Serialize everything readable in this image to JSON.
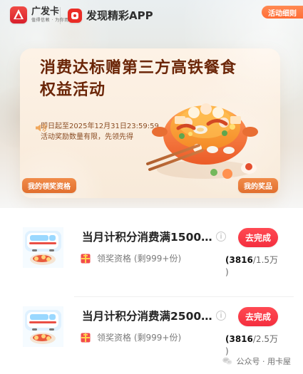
{
  "brand": {
    "name": "广发卡",
    "sub": "值得信赖 · 为你而来"
  },
  "header": {
    "app_promo": "发现精彩APP",
    "activity_detail": "活动细则"
  },
  "hero": {
    "title_line1": "消费达标赠第三方高铁餐食",
    "title_line2": "权益活动",
    "desc_line1": "即日起至2025年12月31日23:59:59,",
    "desc_line2": "活动奖励数量有限，先领先得",
    "left_button": "我的领奖资格",
    "right_button": "我的奖品"
  },
  "tasks": [
    {
      "title": "当月计积分消费满1500...",
      "reward": "领奖资格 (剩999+份)",
      "button": "去完成",
      "progress_prefix": "(3816",
      "progress_total": "/1.5万",
      "progress_suffix": ")"
    },
    {
      "title": "当月计积分消费满2500...",
      "reward": "领奖资格 (剩999+份)",
      "button": "去完成",
      "progress_prefix": "(3816",
      "progress_total": "/2.5万",
      "progress_suffix": ")"
    }
  ],
  "footer": {
    "watermark": "公众号 · 用卡屋"
  },
  "icons": {
    "brand_logo": "brand-logo",
    "app_icon": "app-icon",
    "speaker_icon": "speaker-icon",
    "hotpot_illustration": "hotpot-illustration",
    "train_food_thumb": "train-food-thumbnail",
    "gift_icon": "gift-icon",
    "info_icon": "info-icon",
    "wechat_icon": "wechat-icon"
  },
  "colors": {
    "accent_red": "#f42e3e",
    "accent_orange": "#ff6d36",
    "title_brown": "#6b2608",
    "card_bg": "#f8ead9"
  }
}
